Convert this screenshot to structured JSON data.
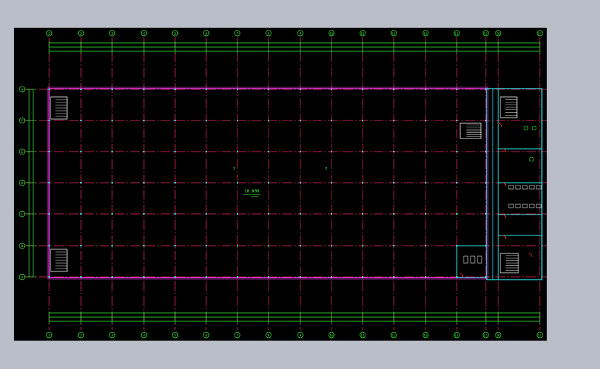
{
  "drawing": {
    "colors": {
      "background": "#000000",
      "frame": "#b9bec9",
      "grid_axis": "#ff2a6d",
      "outline": "#ff40ff",
      "dimension": "#3dff3d",
      "wall": "#2cf0f0",
      "fixture": "#ffffff",
      "door": "#ff3030"
    },
    "column_axes": [
      "1",
      "2",
      "3",
      "4",
      "5",
      "6",
      "7",
      "8",
      "9",
      "10",
      "11",
      "12",
      "13",
      "14",
      "15",
      "16",
      "17"
    ],
    "row_axes": [
      "G",
      "F",
      "E",
      "D",
      "C",
      "B",
      "A"
    ],
    "elevation_label": "10.000",
    "room_marks": [
      "?",
      "?"
    ]
  }
}
